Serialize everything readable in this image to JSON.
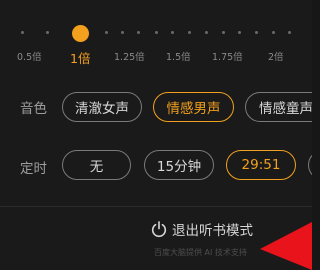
{
  "speed": {
    "options": [
      "0.5倍",
      "1倍",
      "1.25倍",
      "1.5倍",
      "1.75倍",
      "2倍"
    ],
    "selected": "1倍"
  },
  "voice": {
    "label": "音色",
    "options": [
      "清澈女声",
      "情感男声",
      "情感童声"
    ],
    "selected": "情感男声"
  },
  "timer": {
    "label": "定时",
    "options": [
      "无",
      "15分钟",
      "29:51"
    ],
    "selected": "29:51"
  },
  "exit": {
    "label": "退出听书模式",
    "icon": "power-icon"
  },
  "footer": {
    "note": "百度大脑提供 AI 技术支持"
  },
  "colors": {
    "accent": "#f2a01d",
    "background": "#1a1a1a",
    "annotation_arrow": "#e8131b"
  }
}
